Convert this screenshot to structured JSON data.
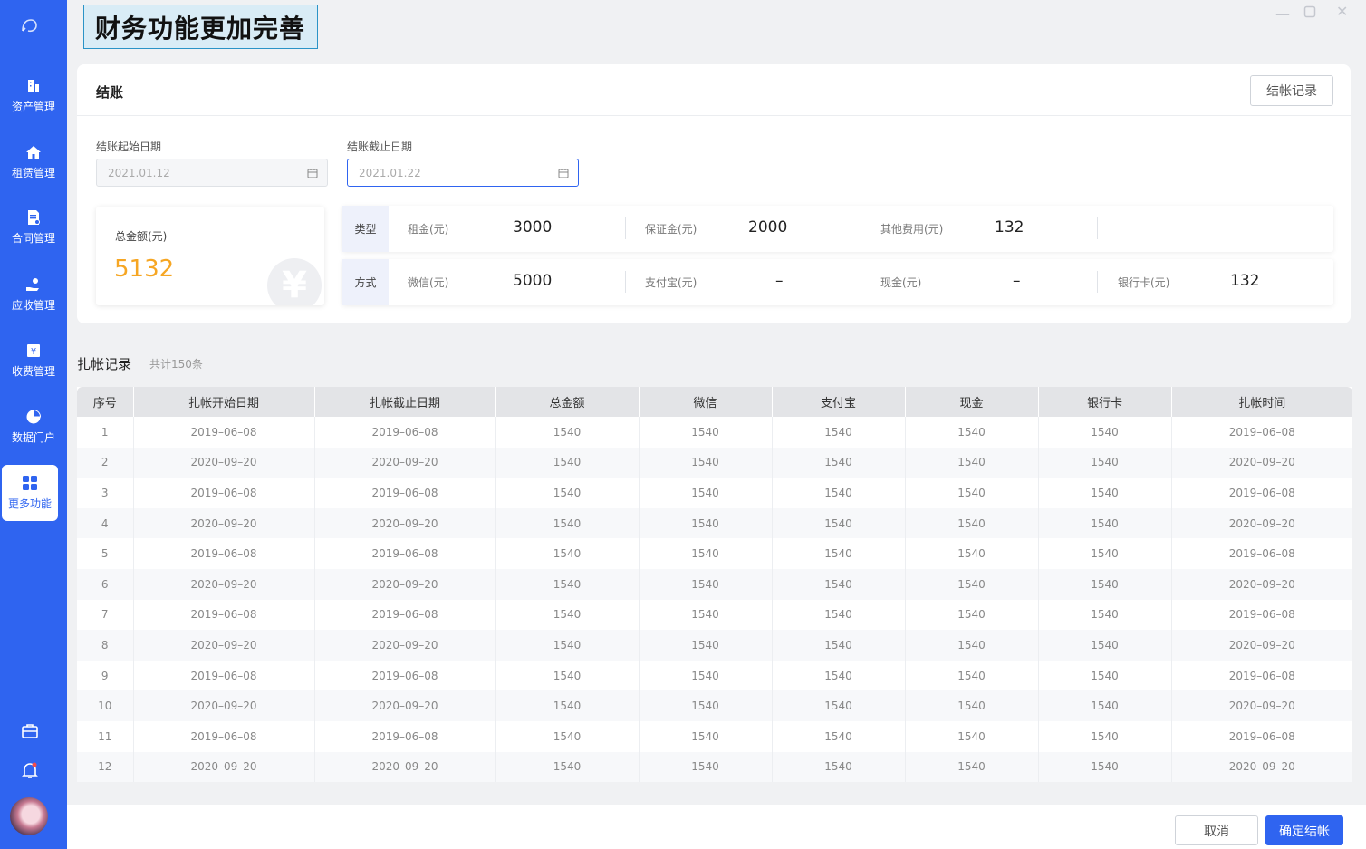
{
  "banner": {
    "text": "财务功能更加完善"
  },
  "sidebar": {
    "items": [
      {
        "label": "资产管理",
        "icon": "building-icon"
      },
      {
        "label": "租赁管理",
        "icon": "home-icon"
      },
      {
        "label": "合同管理",
        "icon": "document-icon"
      },
      {
        "label": "应收管理",
        "icon": "hand-coin-icon"
      },
      {
        "label": "收费管理",
        "icon": "receipt-icon"
      },
      {
        "label": "数据门户",
        "icon": "pie-chart-icon"
      },
      {
        "label": "更多功能",
        "icon": "grid-icon",
        "active": true
      }
    ],
    "accent": "#2f64f0"
  },
  "checkout": {
    "title": "结账",
    "record_button": "结帐记录",
    "start_label": "结账起始日期",
    "start_value": "2021.01.12",
    "end_label": "结账截止日期",
    "end_value": "2021.01.22",
    "total_label": "总金额(元)",
    "total_value": "5132",
    "total_color": "#f6a623",
    "type_row": {
      "head": "类型",
      "items": [
        {
          "label": "租金(元)",
          "value": "3000"
        },
        {
          "label": "保证金(元)",
          "value": "2000"
        },
        {
          "label": "其他费用(元)",
          "value": "132"
        }
      ]
    },
    "method_row": {
      "head": "方式",
      "items": [
        {
          "label": "微信(元)",
          "value": "5000"
        },
        {
          "label": "支付宝(元)",
          "value": "–"
        },
        {
          "label": "现金(元)",
          "value": "–"
        },
        {
          "label": "银行卡(元)",
          "value": "132"
        }
      ]
    }
  },
  "records": {
    "title": "扎帐记录",
    "count": "共计150条",
    "columns": [
      "序号",
      "扎帐开始日期",
      "扎帐截止日期",
      "总金额",
      "微信",
      "支付宝",
      "现金",
      "银行卡",
      "扎帐时间"
    ],
    "rows": [
      [
        "1",
        "2019–06–08",
        "2019–06–08",
        "1540",
        "1540",
        "1540",
        "1540",
        "1540",
        "2019–06–08"
      ],
      [
        "2",
        "2020–09–20",
        "2020–09–20",
        "1540",
        "1540",
        "1540",
        "1540",
        "1540",
        "2020–09–20"
      ],
      [
        "3",
        "2019–06–08",
        "2019–06–08",
        "1540",
        "1540",
        "1540",
        "1540",
        "1540",
        "2019–06–08"
      ],
      [
        "4",
        "2020–09–20",
        "2020–09–20",
        "1540",
        "1540",
        "1540",
        "1540",
        "1540",
        "2020–09–20"
      ],
      [
        "5",
        "2019–06–08",
        "2019–06–08",
        "1540",
        "1540",
        "1540",
        "1540",
        "1540",
        "2019–06–08"
      ],
      [
        "6",
        "2020–09–20",
        "2020–09–20",
        "1540",
        "1540",
        "1540",
        "1540",
        "1540",
        "2020–09–20"
      ],
      [
        "7",
        "2019–06–08",
        "2019–06–08",
        "1540",
        "1540",
        "1540",
        "1540",
        "1540",
        "2019–06–08"
      ],
      [
        "8",
        "2020–09–20",
        "2020–09–20",
        "1540",
        "1540",
        "1540",
        "1540",
        "1540",
        "2020–09–20"
      ],
      [
        "9",
        "2019–06–08",
        "2019–06–08",
        "1540",
        "1540",
        "1540",
        "1540",
        "1540",
        "2019–06–08"
      ],
      [
        "10",
        "2020–09–20",
        "2020–09–20",
        "1540",
        "1540",
        "1540",
        "1540",
        "1540",
        "2020–09–20"
      ],
      [
        "11",
        "2019–06–08",
        "2019–06–08",
        "1540",
        "1540",
        "1540",
        "1540",
        "1540",
        "2019–06–08"
      ],
      [
        "12",
        "2020–09–20",
        "2020–09–20",
        "1540",
        "1540",
        "1540",
        "1540",
        "1540",
        "2020–09–20"
      ]
    ]
  },
  "footer": {
    "cancel": "取消",
    "confirm": "确定结帐"
  }
}
